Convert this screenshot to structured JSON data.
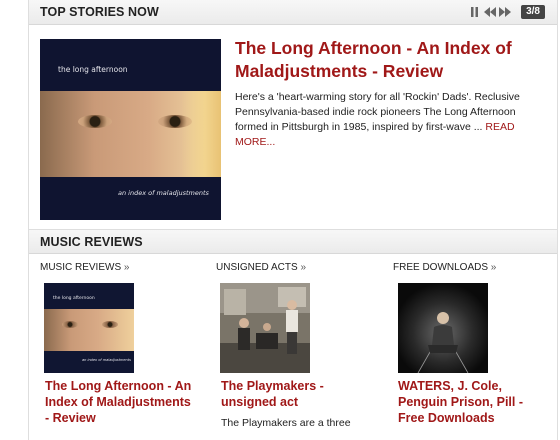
{
  "top_stories": {
    "heading": "TOP STORIES NOW",
    "counter": "3/8",
    "featured": {
      "album_title": "the long afternoon",
      "album_subtitle": "an index of maladjustments",
      "title": "The Long Afternoon - An Index of Maladjustments - Review",
      "body": "Here's a 'heart-warming story for all 'Rockin' Dads'. Reclusive Pennsylvania-based indie rock pioneers The Long Afternoon formed in Pittsburgh in 1985, inspired by first-wave ...",
      "read_more": "READ MORE..."
    },
    "controls": [
      "pause-icon",
      "prev-icon",
      "next-icon"
    ]
  },
  "music_reviews": {
    "heading": "MUSIC REVIEWS",
    "columns": [
      {
        "label": "MUSIC REVIEWS",
        "arrow": "»",
        "thumb_text_top": "the long afternoon",
        "thumb_text_bottom": "an index of maladjustments",
        "title": "The Long Afternoon - An Index of Maladjustments - Review",
        "body": ""
      },
      {
        "label": "UNSIGNED ACTS",
        "arrow": "»",
        "title": "The Playmakers - unsigned act",
        "body": "The Playmakers are a three"
      },
      {
        "label": "FREE DOWNLOADS",
        "arrow": "»",
        "title": "WATERS, J. Cole, Penguin Prison, Pill - Free Downloads",
        "body": ""
      }
    ]
  },
  "colors": {
    "accent_red": "#a01818",
    "header_bg": "#ebebeb",
    "counter_bg": "#444444"
  }
}
